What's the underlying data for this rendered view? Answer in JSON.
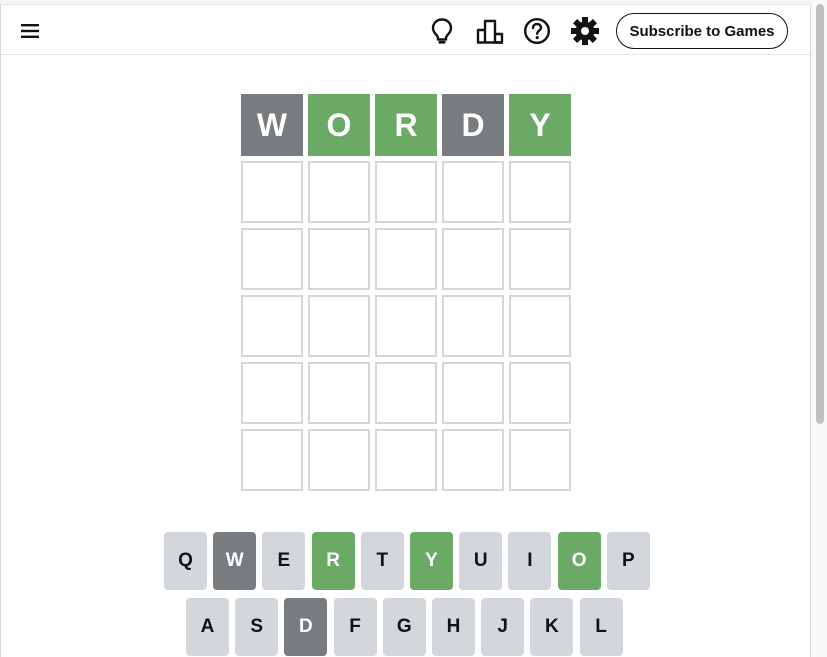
{
  "header": {
    "menu_icon": "hamburger-menu-icon",
    "hint_icon": "lightbulb-icon",
    "stats_icon": "bar-chart-icon",
    "help_icon": "question-mark-icon",
    "settings_icon": "gear-icon",
    "subscribe_label": "Subscribe to Games"
  },
  "colors": {
    "correct": "#6aaa64",
    "absent": "#787c7e",
    "key_default": "#d3d6da",
    "empty_border": "#d3d6da"
  },
  "board": {
    "rows": [
      [
        {
          "letter": "W",
          "state": "absent"
        },
        {
          "letter": "O",
          "state": "correct"
        },
        {
          "letter": "R",
          "state": "correct"
        },
        {
          "letter": "D",
          "state": "absent"
        },
        {
          "letter": "Y",
          "state": "correct"
        }
      ],
      [
        {
          "letter": "",
          "state": "empty"
        },
        {
          "letter": "",
          "state": "empty"
        },
        {
          "letter": "",
          "state": "empty"
        },
        {
          "letter": "",
          "state": "empty"
        },
        {
          "letter": "",
          "state": "empty"
        }
      ],
      [
        {
          "letter": "",
          "state": "empty"
        },
        {
          "letter": "",
          "state": "empty"
        },
        {
          "letter": "",
          "state": "empty"
        },
        {
          "letter": "",
          "state": "empty"
        },
        {
          "letter": "",
          "state": "empty"
        }
      ],
      [
        {
          "letter": "",
          "state": "empty"
        },
        {
          "letter": "",
          "state": "empty"
        },
        {
          "letter": "",
          "state": "empty"
        },
        {
          "letter": "",
          "state": "empty"
        },
        {
          "letter": "",
          "state": "empty"
        }
      ],
      [
        {
          "letter": "",
          "state": "empty"
        },
        {
          "letter": "",
          "state": "empty"
        },
        {
          "letter": "",
          "state": "empty"
        },
        {
          "letter": "",
          "state": "empty"
        },
        {
          "letter": "",
          "state": "empty"
        }
      ],
      [
        {
          "letter": "",
          "state": "empty"
        },
        {
          "letter": "",
          "state": "empty"
        },
        {
          "letter": "",
          "state": "empty"
        },
        {
          "letter": "",
          "state": "empty"
        },
        {
          "letter": "",
          "state": "empty"
        }
      ]
    ]
  },
  "keyboard": {
    "rows": [
      [
        {
          "key": "Q",
          "state": "default"
        },
        {
          "key": "W",
          "state": "absent"
        },
        {
          "key": "E",
          "state": "default"
        },
        {
          "key": "R",
          "state": "correct"
        },
        {
          "key": "T",
          "state": "default"
        },
        {
          "key": "Y",
          "state": "correct"
        },
        {
          "key": "U",
          "state": "default"
        },
        {
          "key": "I",
          "state": "default"
        },
        {
          "key": "O",
          "state": "correct"
        },
        {
          "key": "P",
          "state": "default"
        }
      ],
      [
        {
          "key": "A",
          "state": "default"
        },
        {
          "key": "S",
          "state": "default"
        },
        {
          "key": "D",
          "state": "absent"
        },
        {
          "key": "F",
          "state": "default"
        },
        {
          "key": "G",
          "state": "default"
        },
        {
          "key": "H",
          "state": "default"
        },
        {
          "key": "J",
          "state": "default"
        },
        {
          "key": "K",
          "state": "default"
        },
        {
          "key": "L",
          "state": "default"
        }
      ]
    ]
  }
}
